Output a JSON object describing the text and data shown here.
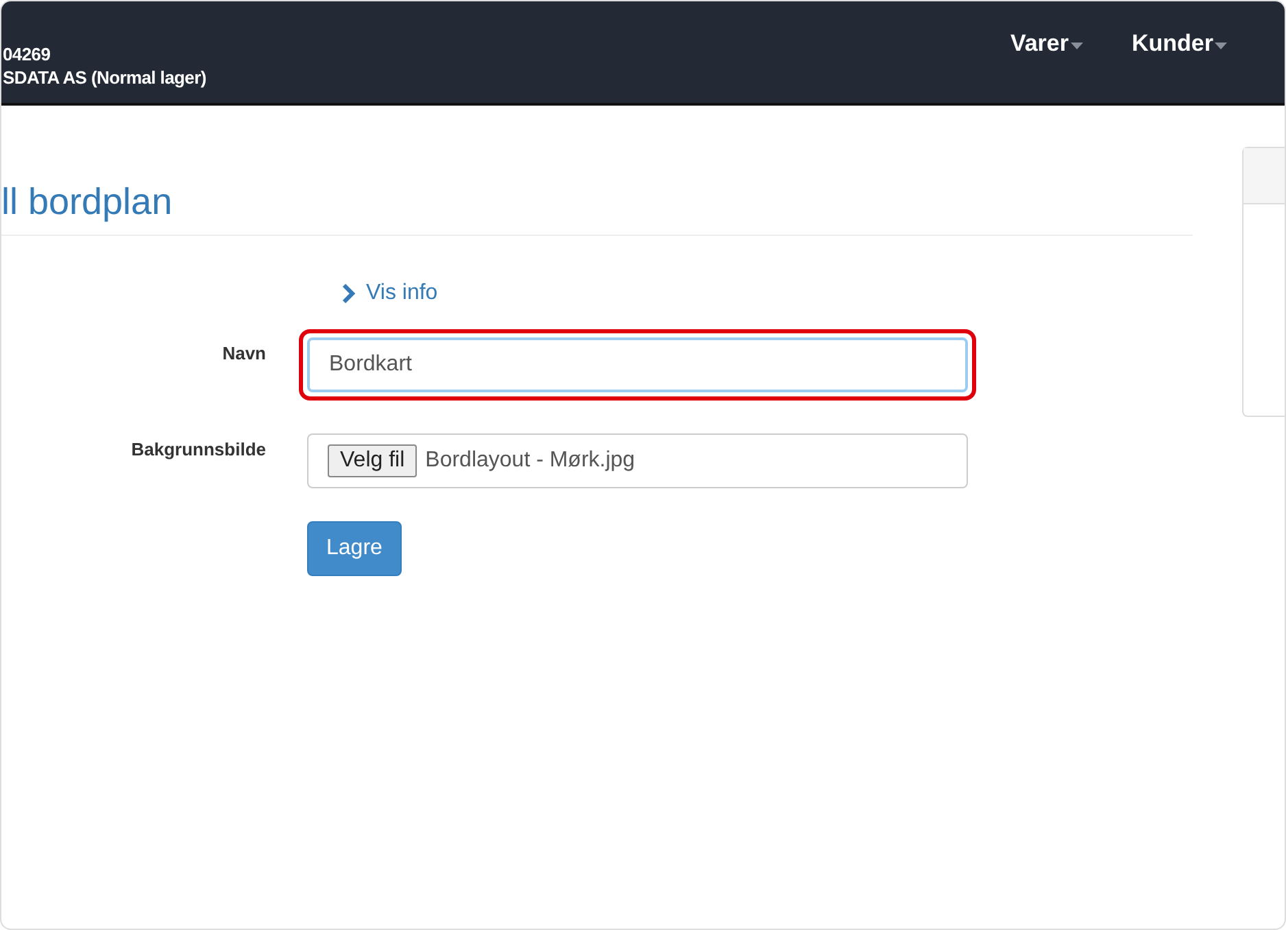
{
  "navbar": {
    "account_lines": [
      "04269",
      "SDATA AS (Normal lager)"
    ],
    "menus": [
      {
        "label": "Varer"
      },
      {
        "label": "Kunder"
      }
    ]
  },
  "page": {
    "title": "ll bordplan",
    "info_link": "Vis info",
    "fields": [
      {
        "kind": "text",
        "label": "Navn",
        "value": "Bordkart",
        "highlighted": true
      },
      {
        "kind": "file",
        "label": "Bakgrunnsbilde",
        "button": "Velg fil",
        "value": "Bordlayout - Mørk.jpg",
        "highlighted": false
      }
    ],
    "submit": "Lagre"
  }
}
